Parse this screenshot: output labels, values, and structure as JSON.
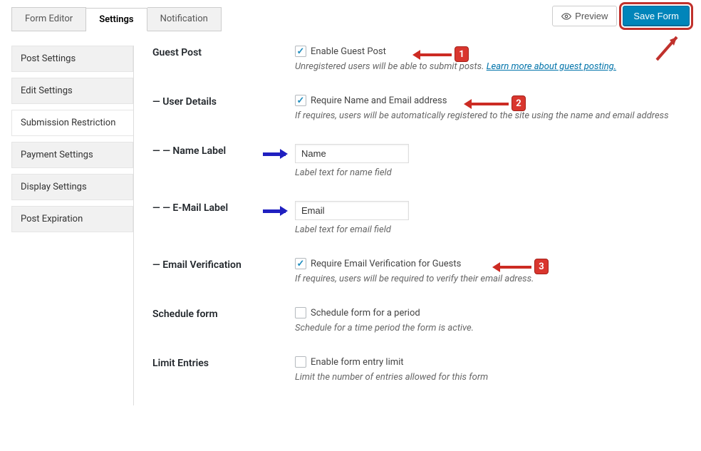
{
  "tabs": {
    "form_editor": "Form Editor",
    "settings": "Settings",
    "notification": "Notification"
  },
  "actions": {
    "preview": "Preview",
    "save": "Save Form"
  },
  "sidebar": {
    "items": [
      "Post Settings",
      "Edit Settings",
      "Submission Restriction",
      "Payment Settings",
      "Display Settings",
      "Post Expiration"
    ]
  },
  "sections": {
    "guest_post": {
      "label": "Guest Post",
      "check_label": "Enable Guest Post",
      "desc_text": "Unregistered users will be able to submit posts. ",
      "desc_link": "Learn more about guest posting."
    },
    "user_details": {
      "label": "— User Details",
      "check_label": "Require Name and Email address",
      "desc": "If requires, users will be automatically registered to the site using the name and email address"
    },
    "name_label": {
      "label": "— — Name Label",
      "value": "Name",
      "desc": "Label text for name field"
    },
    "email_label": {
      "label": "— — E-Mail Label",
      "value": "Email",
      "desc": "Label text for email field"
    },
    "email_verification": {
      "label": "— Email Verification",
      "check_label": "Require Email Verification for Guests",
      "desc": "If requires, users will be required to verify their email adress."
    },
    "schedule": {
      "label": "Schedule form",
      "check_label": "Schedule form for a period",
      "desc": "Schedule for a time period the form is active."
    },
    "limit": {
      "label": "Limit Entries",
      "check_label": "Enable form entry limit",
      "desc": "Limit the number of entries allowed for this form"
    }
  },
  "annotations": {
    "b1": "1",
    "b2": "2",
    "b3": "3"
  }
}
